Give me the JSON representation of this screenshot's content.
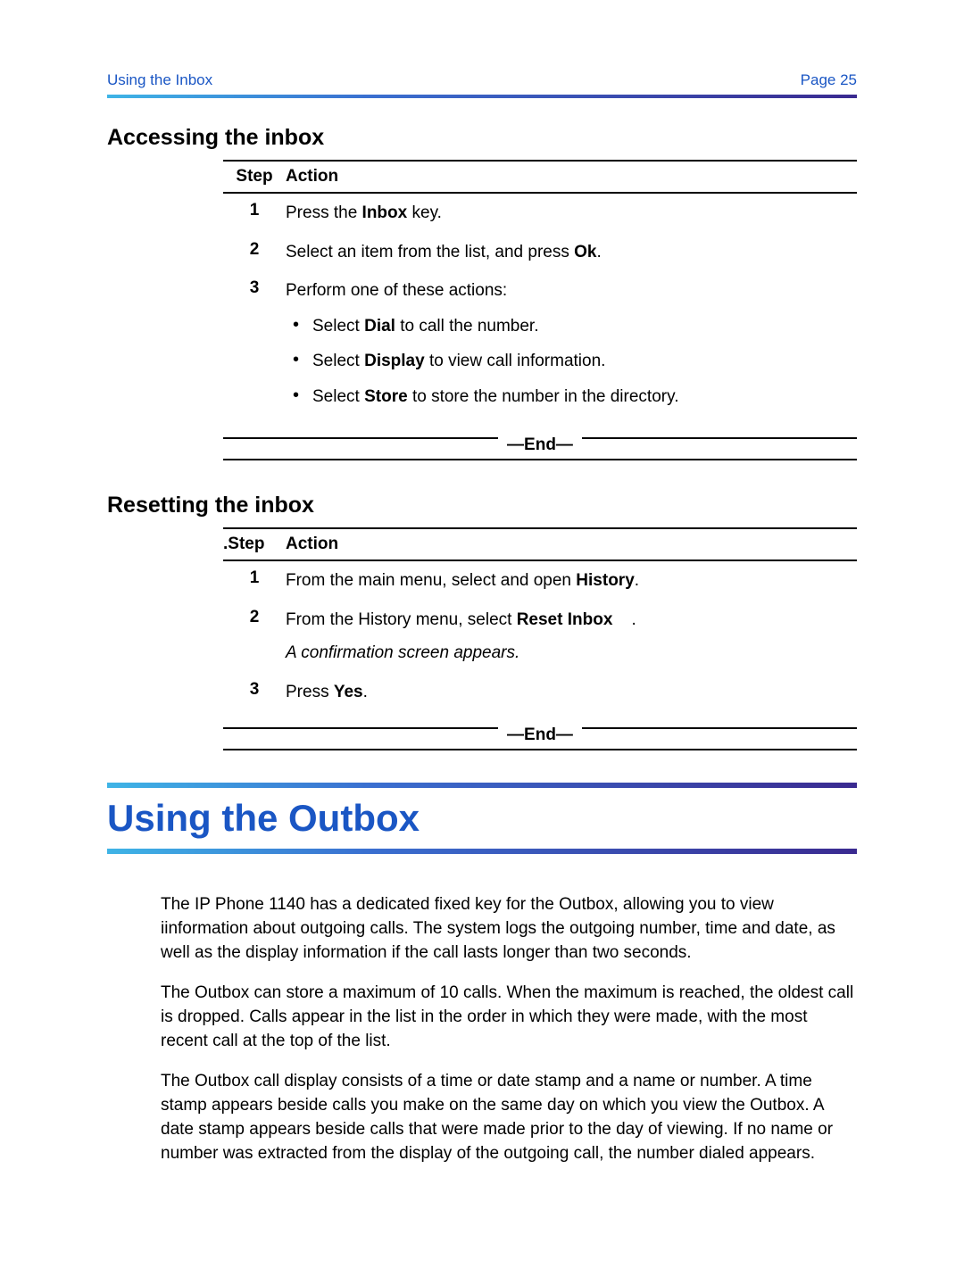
{
  "header": {
    "left": "Using the Inbox",
    "right": "Page 25"
  },
  "section_a": {
    "title": "Accessing the inbox",
    "cols": {
      "step": "Step",
      "action": "Action"
    },
    "steps": [
      {
        "n": "1",
        "pre": "Press the ",
        "b": "Inbox",
        "post": " key."
      },
      {
        "n": "2",
        "pre": "Select an item from the list, and press ",
        "b": "Ok",
        "post": "."
      },
      {
        "n": "3",
        "pre": "Perform one of these actions:",
        "bullets": [
          {
            "pre": "Select ",
            "b": "Dial",
            "post": " to call the number."
          },
          {
            "pre": "Select ",
            "b": "Display",
            "post": " to view call information."
          },
          {
            "pre": "Select ",
            "b": "Store",
            "post": " to store the number in the directory."
          }
        ]
      }
    ],
    "end": "—End—"
  },
  "section_b": {
    "title": "Resetting the inbox",
    "cols": {
      "step": ".Step",
      "action": "Action"
    },
    "steps": [
      {
        "n": "1",
        "pre": "From the main menu, select and open ",
        "b": "History",
        "post": "."
      },
      {
        "n": "2",
        "pre": "From the History menu, select ",
        "b": "Reset Inbox",
        "post": "    .",
        "note": "A confirmation screen appears."
      },
      {
        "n": "3",
        "pre": "Press ",
        "b": "Yes",
        "post": "."
      }
    ],
    "end": "—End—"
  },
  "chapter": {
    "title": "Using the Outbox",
    "p1": "The IP Phone 1140 has a dedicated fixed key for the Outbox, allowing you to view iinformation about outgoing calls. The system logs the outgoing number, time and date, as well as the display information if the call lasts longer than two seconds.",
    "p2": "The Outbox can store a maximum of 10 calls. When the maximum is reached, the oldest call is dropped. Calls appear in the list in the order in which they were made, with the most recent call at the top of the list.",
    "p3": "The Outbox call display consists of a time or date stamp and a name or number. A time stamp appears beside calls you make on the same day on which you view the Outbox. A date stamp appears beside calls that were made prior to the day of viewing. If no name or number was extracted from the display of the outgoing call, the number dialed appears."
  }
}
